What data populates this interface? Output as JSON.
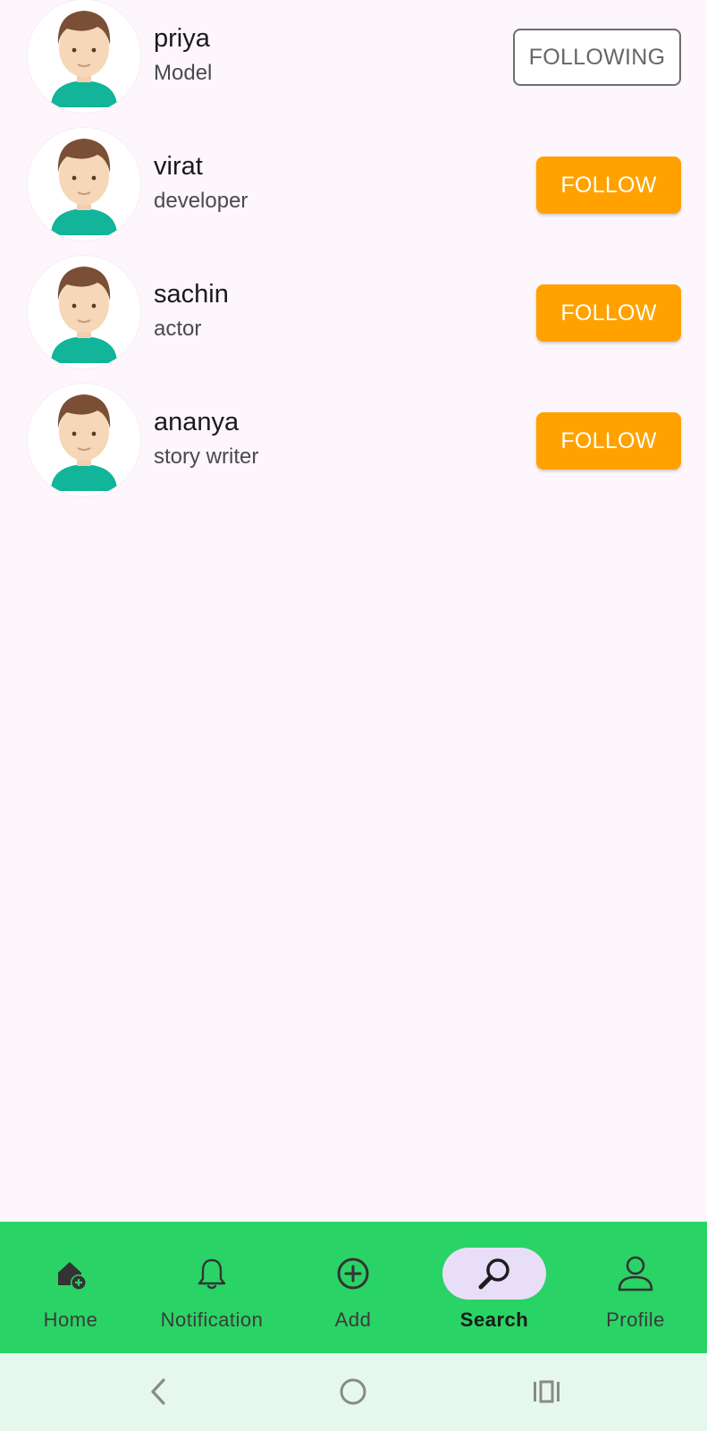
{
  "users": [
    {
      "name": "priya",
      "role": "Model",
      "button": "FOLLOWING"
    },
    {
      "name": "virat",
      "role": "developer",
      "button": "FOLLOW"
    },
    {
      "name": "sachin",
      "role": "actor",
      "button": "FOLLOW"
    },
    {
      "name": "ananya",
      "role": "story writer",
      "button": "FOLLOW"
    }
  ],
  "nav": {
    "items": [
      {
        "label": "Home",
        "icon": "home-add-icon"
      },
      {
        "label": "Notification",
        "icon": "bell-icon"
      },
      {
        "label": "Add",
        "icon": "add-circle-icon"
      },
      {
        "label": "Search",
        "icon": "search-icon"
      },
      {
        "label": "Profile",
        "icon": "person-icon"
      }
    ],
    "active": "Search"
  },
  "system_nav": {
    "icons": [
      "back-icon",
      "home-circle-icon",
      "recents-icon"
    ]
  },
  "colors": {
    "follow_button": "#ffa200",
    "nav_bar": "#2ad365",
    "active_pill": "#e9def8",
    "page_background": "#fdf6fc"
  }
}
